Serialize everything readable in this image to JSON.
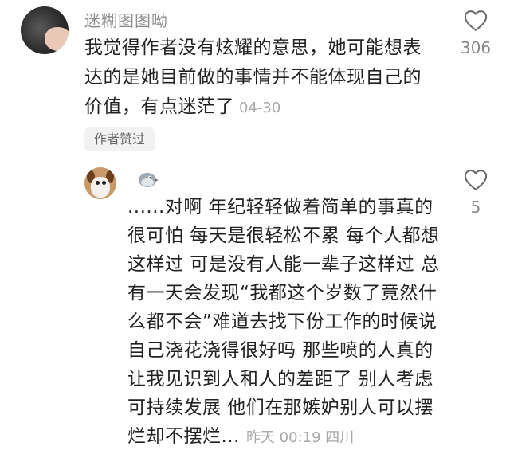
{
  "comment": {
    "username": "迷糊图图呦",
    "text": "我觉得作者没有炫耀的意思，她可能想表达的是她目前做的事情并不能体现自己的价值，有点迷茫了",
    "time": "04-30",
    "like_count": "306",
    "author_badge": "作者赞过",
    "avatar_icon": "user-avatar-icon",
    "like_icon": "heart-outline-icon"
  },
  "reply": {
    "username_icon": "bird-emoji-icon",
    "text": "......对啊 年纪轻轻做着简单的事真的很可怕 每天是很轻松不累 每个人都想这样过 可是没有人能一辈子这样过 总有一天会发现“我都这个岁数了竟然什么都不会”难道去找下份工作的时候说自己浇花浇得很好吗 那些喷的人真的让我见识到人和人的差距了 别人考虑可持续发展 他们在那嫉妒别人可以摆烂却不摆烂...",
    "time": "昨天 00:19 四川",
    "like_count": "5",
    "avatar_icon": "dog-avatar-icon",
    "like_icon": "heart-outline-icon"
  },
  "colors": {
    "text": "#222222",
    "meta": "#a8a8a8",
    "username": "#8e8e8e",
    "badge_bg": "#f2f2f2"
  }
}
